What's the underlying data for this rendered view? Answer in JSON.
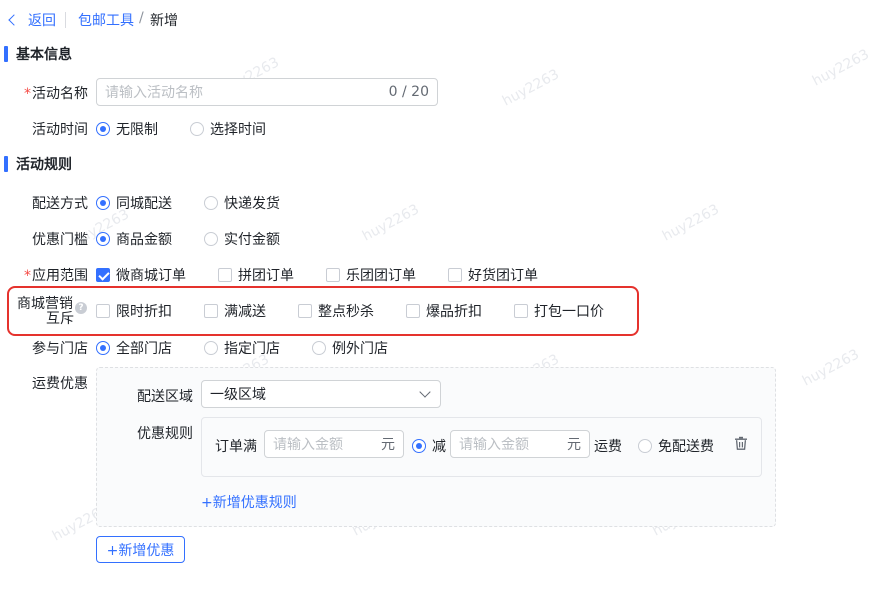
{
  "breadcrumb": {
    "back_label": "返回",
    "parent_label": "包邮工具",
    "separator": "/",
    "current_label": "新增"
  },
  "sections": {
    "basic": "基本信息",
    "rules": "活动规则"
  },
  "required_mark": "*",
  "activity_name": {
    "label": "活动名称",
    "placeholder": "请输入活动名称",
    "counter": "0 / 20"
  },
  "activity_time": {
    "label": "活动时间",
    "options": [
      "无限制",
      "选择时间"
    ],
    "selected": 0
  },
  "delivery": {
    "label": "配送方式",
    "options": [
      "同城配送",
      "快递发货"
    ],
    "selected": 0
  },
  "threshold": {
    "label": "优惠门槛",
    "options": [
      "商品金额",
      "实付金额"
    ],
    "selected": 0
  },
  "scope": {
    "label": "应用范围",
    "options": [
      "微商城订单",
      "拼团订单",
      "乐团团订单",
      "好货团订单"
    ],
    "checked": [
      true,
      false,
      false,
      false
    ]
  },
  "exclusion": {
    "label_line1": "商城营销",
    "label_line2": "互斥",
    "help_glyph": "?",
    "options": [
      "限时折扣",
      "满减送",
      "整点秒杀",
      "爆品折扣",
      "打包一口价"
    ],
    "checked": [
      false,
      false,
      false,
      false,
      false
    ]
  },
  "stores": {
    "label": "参与门店",
    "options": [
      "全部门店",
      "指定门店",
      "例外门店"
    ],
    "selected": 0
  },
  "shipping": {
    "label": "运费优惠",
    "area_label": "配送区域",
    "area_value": "一级区域",
    "rule_label": "优惠规则",
    "order_full_label": "订单满",
    "amount_placeholder": "请输入金额",
    "yuan": "元",
    "reduce_label": "减",
    "fee_label": "运费",
    "free_label": "免配送费",
    "reduce_selected": true,
    "add_rule_label": "+新增优惠规则"
  },
  "add_discount_label": "+新增优惠",
  "watermark": "huy2263",
  "colors": {
    "primary": "#3370ff",
    "required": "#f54a45",
    "highlight": "#e5322d"
  }
}
